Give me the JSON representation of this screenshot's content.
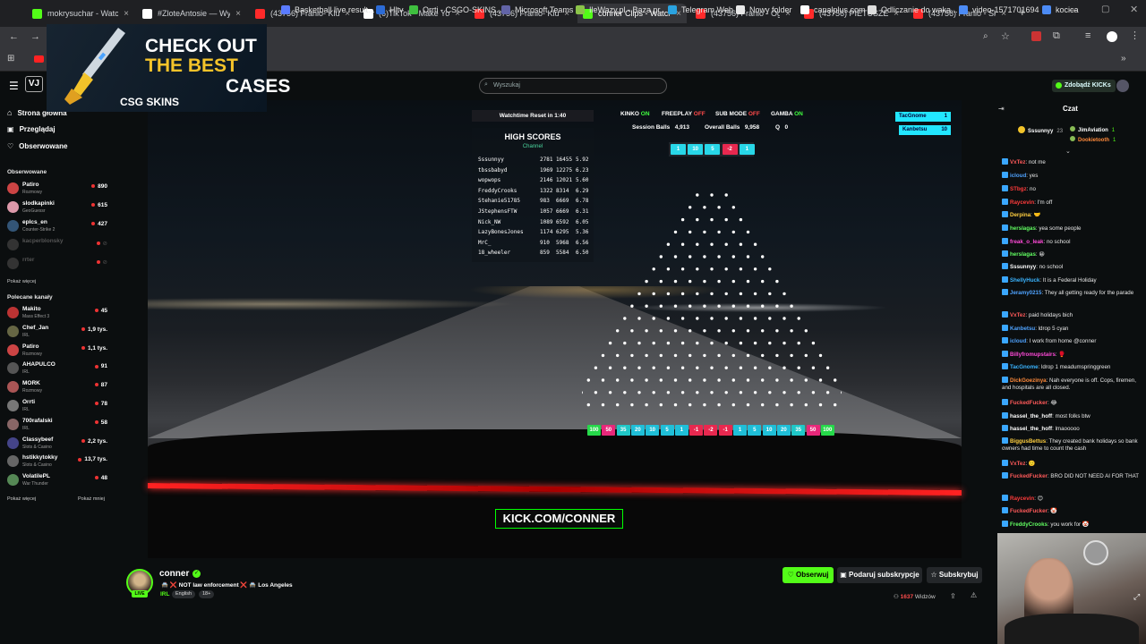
{
  "browser": {
    "tabs": [
      {
        "label": "mokrysuchar - Watch",
        "color": "#53fc18",
        "active": false
      },
      {
        "label": "#ZloteAntosie — Wy",
        "color": "#ffffff",
        "active": false
      },
      {
        "label": "(43756) Franio- Klub",
        "color": "#ff2a2a",
        "active": false
      },
      {
        "label": "(6)TikTok - Make You",
        "color": "#ffffff",
        "active": false
      },
      {
        "label": "(43756) Franio- Klub",
        "color": "#ff2a2a",
        "active": false
      },
      {
        "label": "conner Clips - Watch",
        "color": "#53fc18",
        "active": true
      },
      {
        "label": "(43756) Franio - Ogu",
        "color": "#ff2a2a",
        "active": false
      },
      {
        "label": "(43756) PIETUSZEWS",
        "color": "#ff2a2a",
        "active": false
      },
      {
        "label": "(43756) Franio - Sker",
        "color": "#ff2a2a",
        "active": false
      }
    ],
    "bookmarks": [
      {
        "label": "Basketball live result...",
        "color": "#5a7bff"
      },
      {
        "label": "Hltv",
        "color": "#2c6bd6"
      },
      {
        "label": "Orrti - CSGO-SKINS...",
        "color": "#3fbf3f"
      },
      {
        "label": "Microsoft Teams",
        "color": "#6264a7"
      },
      {
        "label": "IleWazy.pl - Baza pr...",
        "color": "#8bc34a"
      },
      {
        "label": "Telegram Web",
        "color": "#2aa3e0"
      },
      {
        "label": "Nowy folder",
        "color": "#e8e8e8"
      },
      {
        "label": "canalplus.com",
        "color": "#ffffff"
      },
      {
        "label": "Odliczanie do waka...",
        "color": "#dddddd"
      },
      {
        "label": "video-1571701694",
        "color": "#4c8bf5"
      },
      {
        "label": "kocica",
        "color": "#4c8bf5"
      }
    ]
  },
  "ad": {
    "line1": "CHECK OUT",
    "line2": "THE BEST",
    "line3": "CASES",
    "brand": "CSG  SKINS"
  },
  "header": {
    "search_placeholder": "Wyszukaj",
    "kicks_button": "Zdobądź KICKs"
  },
  "sidebar": {
    "nav": [
      {
        "label": "Strona główna"
      },
      {
        "label": "Przeglądaj"
      },
      {
        "label": "Obserwowane"
      }
    ],
    "followed_title": "Obserwowane",
    "followed": [
      {
        "name": "Patiro",
        "category": "Rozmowy",
        "viewers": "890",
        "color": "#c44"
      },
      {
        "name": "slodkapinki",
        "category": "GeoGuessr",
        "viewers": "615",
        "color": "#d9a"
      },
      {
        "name": "eplcs_en",
        "category": "Counter-Strike 2",
        "viewers": "427",
        "color": "#357"
      },
      {
        "name": "kacperblonsky",
        "category": "",
        "viewers": "",
        "color": "#333"
      },
      {
        "name": "rrter",
        "category": "",
        "viewers": "",
        "color": "#333"
      }
    ],
    "show_more": "Pokaż więcej",
    "recommended_title": "Polecane kanały",
    "recommended": [
      {
        "name": "Makito",
        "category": "Mass Effect 3",
        "viewers": "45",
        "color": "#b33"
      },
      {
        "name": "Chef_Jan",
        "category": "IRL",
        "viewers": "1,9 tys.",
        "color": "#664"
      },
      {
        "name": "Patiro",
        "category": "Rozmowy",
        "viewers": "1,1 tys.",
        "color": "#c44"
      },
      {
        "name": "AHAPULCO",
        "category": "IRL",
        "viewers": "91",
        "color": "#555"
      },
      {
        "name": "MORK",
        "category": "Rozmowy",
        "viewers": "87",
        "color": "#a55"
      },
      {
        "name": "Orrti",
        "category": "IRL",
        "viewers": "78",
        "color": "#777"
      },
      {
        "name": "700rafalski",
        "category": "IRL",
        "viewers": "58",
        "color": "#866"
      },
      {
        "name": "Classybeef",
        "category": "Slots & Casino",
        "viewers": "2,2 tys.",
        "color": "#448"
      },
      {
        "name": "hstikkytokky",
        "category": "Slots & Casino",
        "viewers": "13,7 tys.",
        "color": "#666"
      },
      {
        "name": "VolatilePL",
        "category": "War Thunder",
        "viewers": "48",
        "color": "#585"
      }
    ],
    "show_more2": "Pokaż więcej",
    "show_less": "Pokaż mniej"
  },
  "hud": {
    "watchtime": "Watchtime Reset in 1:40",
    "kinko": "KINKO",
    "kinko_state": "ON",
    "freeplay": "FREEPLAY",
    "freeplay_state": "OFF",
    "submode": "SUB MODE",
    "submode_state": "OFF",
    "gamba": "GAMBA",
    "gamba_state": "ON",
    "session_balls_label": "Session Balls",
    "session_balls": "4,913",
    "overall_balls_label": "Overall Balls",
    "overall_balls": "9,958",
    "q_label": "Q",
    "q_value": "0",
    "top_chips": [
      {
        "v": "1",
        "c": "#28d7e8"
      },
      {
        "v": "10",
        "c": "#28d7e8"
      },
      {
        "v": "5",
        "c": "#28d7e8"
      },
      {
        "v": "-2",
        "c": "#e8284f"
      },
      {
        "v": "1",
        "c": "#28d7e8"
      }
    ],
    "badges": [
      {
        "name": "TacGnome",
        "v": "1"
      },
      {
        "name": "Kanbetsu",
        "v": "10"
      }
    ],
    "bottom_chips": [
      {
        "v": "100",
        "c": "#26d94a"
      },
      {
        "v": "50",
        "c": "#e8287a"
      },
      {
        "v": "35",
        "c": "#1fc8c8"
      },
      {
        "v": "20",
        "c": "#1fbfd8"
      },
      {
        "v": "10",
        "c": "#1fbfd8"
      },
      {
        "v": "5",
        "c": "#1fbfd8"
      },
      {
        "v": "1",
        "c": "#1fbfd8"
      },
      {
        "v": "-1",
        "c": "#e8284f"
      },
      {
        "v": "-2",
        "c": "#e8284f"
      },
      {
        "v": "-1",
        "c": "#e8284f"
      },
      {
        "v": "1",
        "c": "#1fbfd8"
      },
      {
        "v": "5",
        "c": "#1fbfd8"
      },
      {
        "v": "10",
        "c": "#1fbfd8"
      },
      {
        "v": "20",
        "c": "#1fbfd8"
      },
      {
        "v": "35",
        "c": "#1fc8c8"
      },
      {
        "v": "50",
        "c": "#e8287a"
      },
      {
        "v": "100",
        "c": "#26d94a"
      }
    ]
  },
  "high_scores": {
    "title": "HIGH SCORES",
    "subtitle": "Channel",
    "rows": [
      {
        "name": "Sssunnyy",
        "a": "2781",
        "b": "16455",
        "c": "5.92"
      },
      {
        "name": "tbssbabyd",
        "a": "1969",
        "b": "12275",
        "c": "6.23"
      },
      {
        "name": "wopwops",
        "a": "2146",
        "b": "12021",
        "c": "5.60"
      },
      {
        "name": "FreddyCrooks",
        "a": "1322",
        "b": "8314",
        "c": "6.29"
      },
      {
        "name": "Stehanie51785",
        "a": "983",
        "b": "6669",
        "c": "6.78"
      },
      {
        "name": "JStephensFTW",
        "a": "1057",
        "b": "6669",
        "c": "6.31"
      },
      {
        "name": "Nick_NW",
        "a": "1089",
        "b": "6592",
        "c": "6.05"
      },
      {
        "name": "LazyBonesJones",
        "a": "1174",
        "b": "6295",
        "c": "5.36"
      },
      {
        "name": "MrC_",
        "a": "910",
        "b": "5968",
        "c": "6.56"
      },
      {
        "name": "18_wheeler",
        "a": "859",
        "b": "5584",
        "c": "6.50"
      }
    ]
  },
  "video": {
    "watermark": "KICK.COM/CONNER"
  },
  "channel": {
    "name": "conner",
    "title": "🚔 ❌ NOT law enforcement ❌ 🚔 Los Angeles",
    "category": "IRL",
    "tag_lang": "English",
    "tag_age": "18+",
    "follow": "Obserwuj",
    "gift": "Podaruj subskrypcje",
    "subscribe": "Subskrybuj",
    "viewers": "1637",
    "viewers_label": "Widzów"
  },
  "chat": {
    "title": "Czat",
    "top_gifters": [
      {
        "name": "Sssunnyy",
        "v": "23"
      },
      {
        "name": "JimAviation",
        "v": "1"
      },
      {
        "name": "Dookietooth",
        "v": "1"
      }
    ],
    "messages": [
      {
        "user": "VxTez",
        "color": "#ff5a5a",
        "text": "not me"
      },
      {
        "user": "icloud",
        "color": "#4fa3ff",
        "text": "yes"
      },
      {
        "user": "STbgz",
        "color": "#ff3b3b",
        "text": "no"
      },
      {
        "user": "Raycevin",
        "color": "#ff3b3b",
        "text": "I'm off"
      },
      {
        "user": "Derpina",
        "color": "#ffcf40",
        "text": "🤝"
      },
      {
        "user": "herslagas",
        "color": "#62ff62",
        "text": "yea some people"
      },
      {
        "user": "freak_o_leak",
        "color": "#ff4ad8",
        "text": "no school"
      },
      {
        "user": "herslagas",
        "color": "#62ff62",
        "text": "😀"
      },
      {
        "user": "Sssunnyy",
        "color": "#ffffff",
        "text": "no school"
      },
      {
        "user": "ShellyHuck",
        "color": "#3ab4ff",
        "text": "It is a Federal Holiday"
      },
      {
        "user": "Jeramy0215",
        "color": "#4fa3ff",
        "text": "They all getting ready for the parade"
      },
      {
        "user": "VxTez",
        "color": "#ff5a5a",
        "text": "paid holidays bich"
      },
      {
        "user": "Kanbetsu",
        "color": "#4fa3ff",
        "text": "ldrop 5 cyan"
      },
      {
        "user": "icloud",
        "color": "#4fa3ff",
        "text": "I work from home @conner"
      },
      {
        "user": "Billyfromupstairs",
        "color": "#ff4ad8",
        "text": "🥊"
      },
      {
        "user": "TacGnome",
        "color": "#3ab4ff",
        "text": "ldrop 1 meadumspringgreen"
      },
      {
        "user": "DickGoezinya",
        "color": "#ff8a3b",
        "text": "Nah everyone is off. Cops, firemen, and hospitals are all closed."
      },
      {
        "user": "FuckedFucker",
        "color": "#ff5a5a",
        "text": "😂"
      },
      {
        "user": "hassel_the_hoff",
        "color": "#ffffff",
        "text": "most folks btw"
      },
      {
        "user": "hassel_the_hoff",
        "color": "#ffffff",
        "text": "lmaooooo"
      },
      {
        "user": "BiggusBettus",
        "color": "#ffcf40",
        "text": "They created bank holidays so bank owners had time to count the cash"
      },
      {
        "user": "VxTez",
        "color": "#ff5a5a",
        "text": "🙂"
      },
      {
        "user": "FuckedFucker",
        "color": "#ff5a5a",
        "text": "BRO DID NOT NEED AI FOR THAT"
      },
      {
        "user": "Raycevin",
        "color": "#ff3b3b",
        "text": "😊"
      },
      {
        "user": "FuckedFucker",
        "color": "#ff5a5a",
        "text": "🤡"
      },
      {
        "user": "FreddyCrooks",
        "color": "#62ff62",
        "text": "you work for 🤡"
      }
    ]
  }
}
